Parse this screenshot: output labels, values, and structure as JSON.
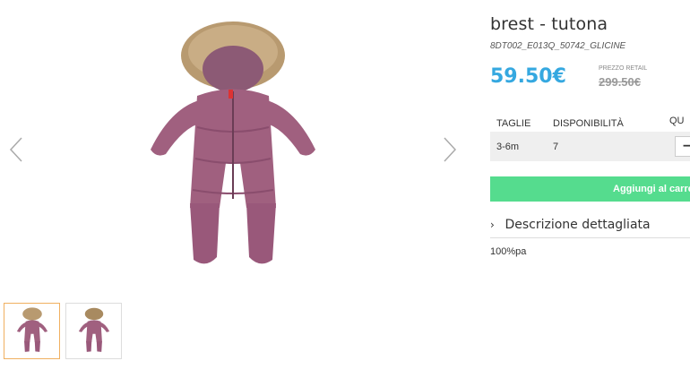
{
  "product": {
    "title": "brest - tutona",
    "sku": "8DT002_E013Q_50742_GLICINE",
    "price": "59.50€",
    "retail_label": "PREZZO RETAIL",
    "retail_price": "299.50€"
  },
  "sizes_table": {
    "headers": [
      "TAGLIE",
      "DISPONIBILITÀ",
      "QU"
    ],
    "rows": [
      {
        "size": "3-6m",
        "availability": "7",
        "qty_symbol": "−"
      }
    ]
  },
  "cart_button": {
    "label": "Aggiungi al carrel"
  },
  "description": {
    "toggle_label": "Descrizione dettagliata",
    "text": "100%pa"
  },
  "gallery": {
    "prev_icon": "chevron-left-icon",
    "next_icon": "chevron-right-icon",
    "thumb_count": 2,
    "active_thumb": 0
  },
  "colors": {
    "price": "#35a8e0",
    "cart_button": "#55dc8e",
    "active_thumb_border": "#f0b060",
    "snowsuit": "#a0607f"
  }
}
